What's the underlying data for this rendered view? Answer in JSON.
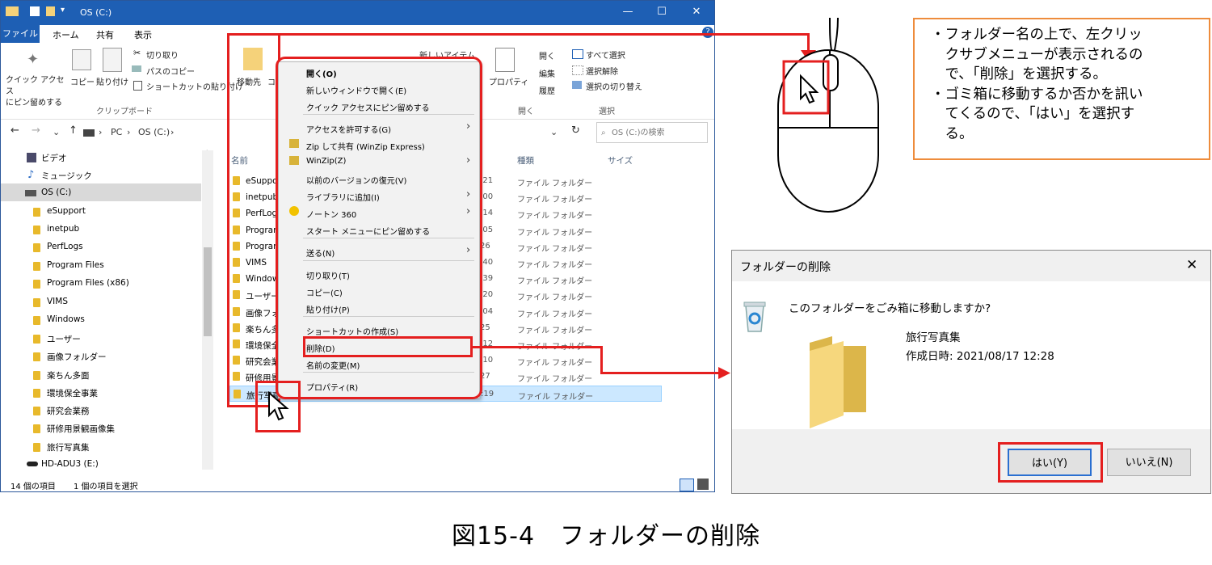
{
  "explorer": {
    "title": "OS (C:)",
    "menu_tabs": [
      "ファイル",
      "ホーム",
      "共有",
      "表示"
    ],
    "ribbon": {
      "clipboard": {
        "pin_label": "クイック アクセス\nにピン留めする",
        "copy_label": "コピー",
        "paste_label": "貼り付け",
        "cut_label": "切り取り",
        "copy_path_label": "パスのコピー",
        "paste_shortcut_label": "ショートカットの貼り付け",
        "group_label": "クリップボード"
      },
      "organize": {
        "move_label": "移動先",
        "copy_label": "コ"
      },
      "new": {
        "new_item_label": "新しいアイテム"
      },
      "open": {
        "properties_label": "プロパティ",
        "open_label": "開く",
        "edit_label": "編集",
        "history_label": "履歴",
        "group_label": "開く"
      },
      "select": {
        "select_all_label": "すべて選択",
        "select_none_label": "選択解除",
        "invert_label": "選択の切り替え",
        "group_label": "選択"
      }
    },
    "address": {
      "pc": "PC",
      "drive": "OS (C:)",
      "search_placeholder": "OS (C:)の検索"
    },
    "nav_items": [
      {
        "label": "ビデオ",
        "type": "video"
      },
      {
        "label": "ミュージック",
        "type": "music"
      },
      {
        "label": "OS (C:)",
        "type": "drive"
      },
      {
        "label": "eSupport",
        "type": "folder"
      },
      {
        "label": "inetpub",
        "type": "folder"
      },
      {
        "label": "PerfLogs",
        "type": "folder"
      },
      {
        "label": "Program Files",
        "type": "folder"
      },
      {
        "label": "Program Files (x86)",
        "type": "folder"
      },
      {
        "label": "VIMS",
        "type": "folder"
      },
      {
        "label": "Windows",
        "type": "folder"
      },
      {
        "label": "ユーザー",
        "type": "folder"
      },
      {
        "label": "画像フォルダー",
        "type": "folder"
      },
      {
        "label": "楽ちん多面",
        "type": "folder"
      },
      {
        "label": "環境保全事業",
        "type": "folder"
      },
      {
        "label": "研究会業務",
        "type": "folder"
      },
      {
        "label": "研修用景観画像集",
        "type": "folder"
      },
      {
        "label": "旅行写真集",
        "type": "folder"
      },
      {
        "label": "HD-ADU3 (E:)",
        "type": "disk"
      }
    ],
    "columns": {
      "name": "名前",
      "type": "種類",
      "size": "サイズ"
    },
    "files": [
      {
        "name": "eSuppo",
        "time": ":21",
        "type": "ファイル フォルダー"
      },
      {
        "name": "inetpub",
        "time": ":00",
        "type": "ファイル フォルダー"
      },
      {
        "name": "PerfLog",
        "time": ":14",
        "type": "ファイル フォルダー"
      },
      {
        "name": "Program",
        "time": ":05",
        "type": "ファイル フォルダー"
      },
      {
        "name": "Program",
        "time": "26",
        "type": "ファイル フォルダー"
      },
      {
        "name": "VIMS",
        "time": ":40",
        "type": "ファイル フォルダー"
      },
      {
        "name": "Window",
        "time": ":39",
        "type": "ファイル フォルダー"
      },
      {
        "name": "ユーザー",
        "time": ":20",
        "type": "ファイル フォルダー"
      },
      {
        "name": "画像フォ",
        "time": ":04",
        "type": "ファイル フォルダー"
      },
      {
        "name": "楽ちん多",
        "time": "25",
        "type": "ファイル フォルダー"
      },
      {
        "name": "環境保全",
        "time": ":12",
        "type": "ファイル フォルダー"
      },
      {
        "name": "研究会業",
        "time": ":10",
        "type": "ファイル フォルダー"
      },
      {
        "name": "研修用景",
        "time": "27",
        "type": "ファイル フォルダー"
      },
      {
        "name": "旅行写真",
        "time": ":19",
        "type": "ファイル フォルダー"
      }
    ],
    "status": {
      "count": "14 個の項目",
      "selected": "1 個の項目を選択"
    }
  },
  "context_menu": {
    "items": [
      {
        "label": "開く(O)",
        "bold": true
      },
      {
        "label": "新しいウィンドウで開く(E)"
      },
      {
        "label": "クイック アクセスにピン留めする"
      },
      {
        "label": "アクセスを許可する(G)",
        "submenu": true
      },
      {
        "label": "Zip して共有 (WinZip Express)"
      },
      {
        "label": "WinZip(Z)",
        "submenu": true
      },
      {
        "label": "以前のバージョンの復元(V)"
      },
      {
        "label": "ライブラリに追加(I)",
        "submenu": true
      },
      {
        "label": "ノートン 360",
        "submenu": true
      },
      {
        "label": "スタート メニューにピン留めする"
      },
      {
        "label": "送る(N)",
        "submenu": true
      },
      {
        "label": "切り取り(T)"
      },
      {
        "label": "コピー(C)"
      },
      {
        "label": "貼り付け(P)"
      },
      {
        "label": "ショートカットの作成(S)"
      },
      {
        "label": "削除(D)"
      },
      {
        "label": "名前の変更(M)"
      },
      {
        "label": "プロパティ(R)"
      }
    ]
  },
  "dialog": {
    "title": "フォルダーの削除",
    "question": "このフォルダーをごみ箱に移動しますか?",
    "folder_name": "旅行写真集",
    "created": "作成日時: 2021/08/17 12:28",
    "yes_label": "はい(Y)",
    "no_label": "いいえ(N)"
  },
  "note": {
    "lines": [
      "・フォルダー名の上で、左クリッ",
      "　クサブメニューが表示されるの",
      "　で、「削除」を選択する。",
      "・ゴミ箱に移動するか否かを訊い",
      "　てくるので、「はい」を選択す",
      "　る。"
    ]
  },
  "caption": "図15-4　フォルダーの削除",
  "colors": {
    "accent": "#1e5fb4",
    "highlight": "#e41f1f",
    "note_border": "#ee8c3c",
    "folder": "#e8b92b"
  }
}
